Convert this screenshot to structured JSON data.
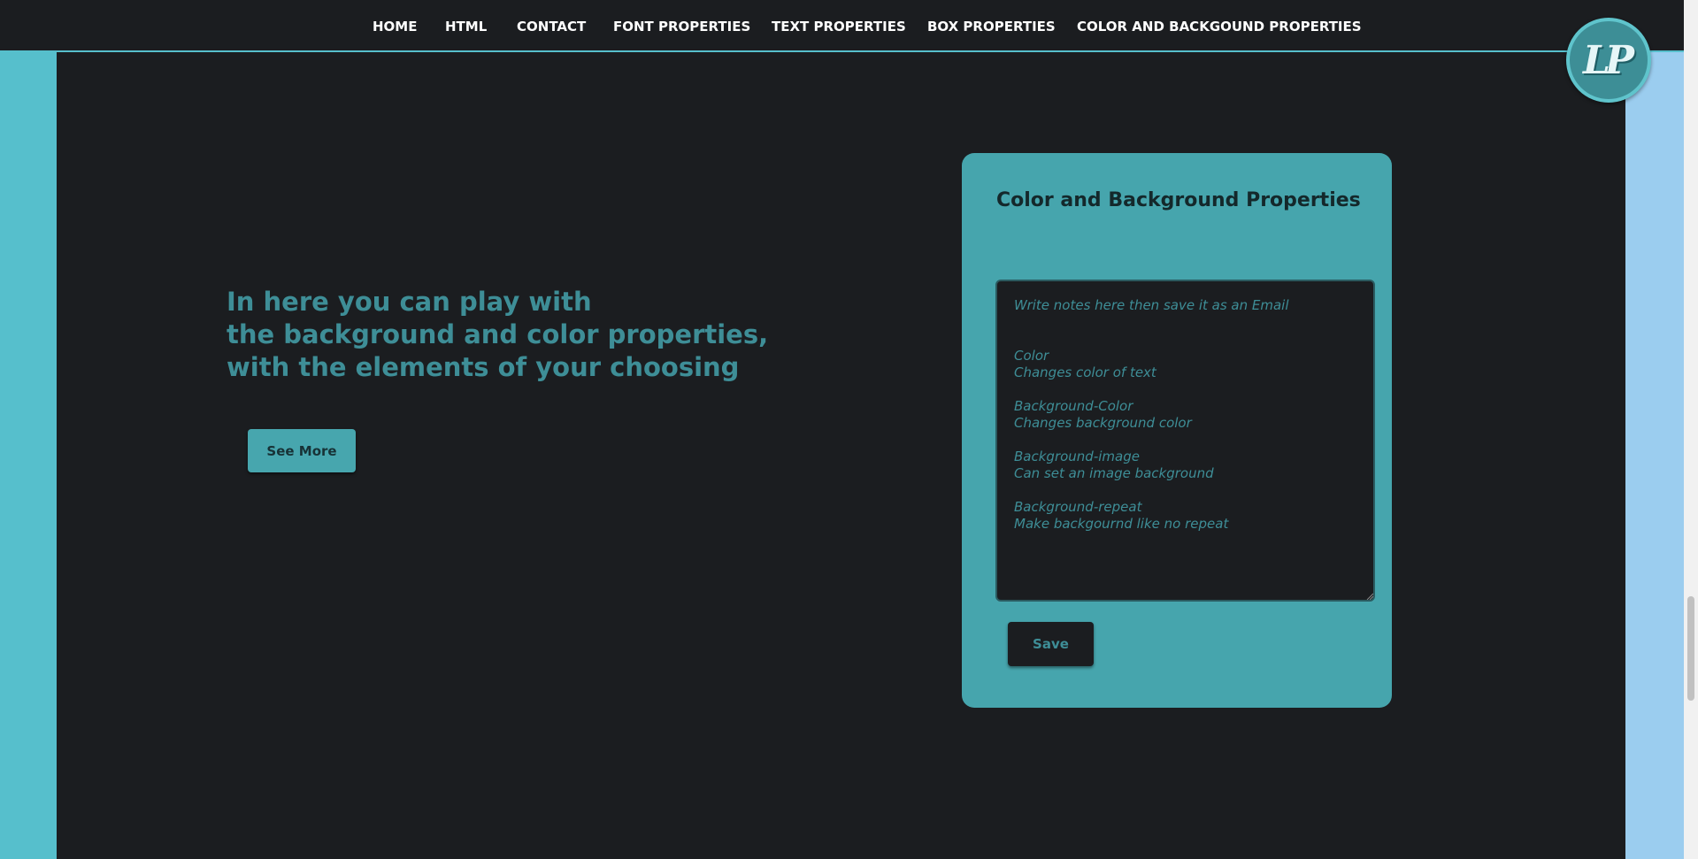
{
  "nav": {
    "items": [
      {
        "label": "HOME"
      },
      {
        "label": "HTML"
      },
      {
        "label": "CONTACT"
      },
      {
        "label": "FONT PROPERTIES"
      },
      {
        "label": "TEXT PROPERTIES"
      },
      {
        "label": "BOX PROPERTIES"
      },
      {
        "label": "COLOR AND BACKGOUND PROPERTIES"
      }
    ]
  },
  "logo": {
    "text": "LP",
    "icon": "lp-logo-icon"
  },
  "intro": {
    "line1": "In here you can play with",
    "line2": "the background and color properties,",
    "line3": "with the elements of your choosing",
    "button_label": "See More"
  },
  "card": {
    "title": "Color and Background Properties",
    "notes_placeholder": "Write notes here then save it as an Email\n\n\nColor\nChanges color of text\n\nBackground-Color\nChanges background color\n\nBackground-image\nCan set an image background\n\nBackground-repeat\nMake backgournd like no repeat",
    "save_label": "Save"
  },
  "colors": {
    "background": "#1b1d20",
    "accent": "#46a5ad",
    "accent_text": "#3e8e97",
    "left_stripe": "#56bfcc",
    "right_stripe": "#9bcdef"
  }
}
